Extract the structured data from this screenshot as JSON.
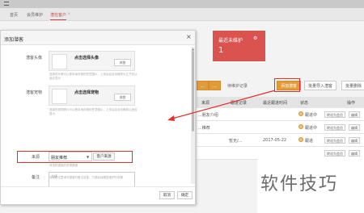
{
  "tabs": [
    {
      "label": "首页",
      "active": false
    },
    {
      "label": "会员维护",
      "active": false
    },
    {
      "label": "潜在客户",
      "active": true
    }
  ],
  "card_red": {
    "title": "最近未维护",
    "value": "1"
  },
  "toolbar": {
    "btn1": "...",
    "btn2": "...",
    "pending": "待维护记录",
    "add_customer": "添加潜客",
    "bulk_import": "批量导入潜客",
    "bulk_delete": "批量删除"
  },
  "table": {
    "headers": [
      "来源",
      "跟进记录",
      "最近跟进时间",
      "状态",
      "操作"
    ],
    "rows": [
      {
        "source": "...朋友介绍",
        "follow": "",
        "date": "",
        "status": "跟进中",
        "actions": [
          "转化为会员",
          "编辑"
        ]
      },
      {
        "source": "...推荐",
        "follow": "",
        "date": "",
        "status": "跟进中",
        "actions": [
          "转化为会员",
          "编辑"
        ]
      },
      {
        "source": "",
        "follow": "暂无/...",
        "date": "2017-05-22",
        "status": "跟进",
        "actions": [
          "转化为会员",
          "编辑"
        ]
      },
      {
        "source": "",
        "follow": "",
        "date": "",
        "status": "",
        "actions": [
          "转化为会员",
          "编辑"
        ]
      }
    ]
  },
  "modal": {
    "title": "添加潜客",
    "close": "×",
    "avatar_label": "潜客头像",
    "avatar_upload": "点击选择头像",
    "avatar_btn": "浏览",
    "avatar_hint": "选择的头像可以是本地存储的任意图片，上传后会自动裁剪为正方形以适应显示",
    "pet_label": "潜客宠物",
    "pet_upload": "点击选择宠物",
    "pet_btn": "浏览",
    "pet_hint": "选择的宠物照片可以是本地存储的任意图片，上传后会自动裁剪以适应显示",
    "source_label": "来源",
    "source_value": "朋友推荐",
    "source_btn": "客户来源",
    "source_hint": "请选择潜客的来源渠道",
    "remark_label": "备注",
    "remark_placeholder": "选填",
    "remark_hint": "可以在这里填写潜客的备注信息，方便后续跟进维护时查看",
    "cancel": "取消",
    "confirm": "确定"
  },
  "watermark": "软件技巧",
  "colors": {
    "highlight": "#e0302b",
    "green_card": "#67b45a",
    "red_card": "#d9534f",
    "orange_btn": "#e29b3b",
    "active_tab": "#c94a4a"
  }
}
